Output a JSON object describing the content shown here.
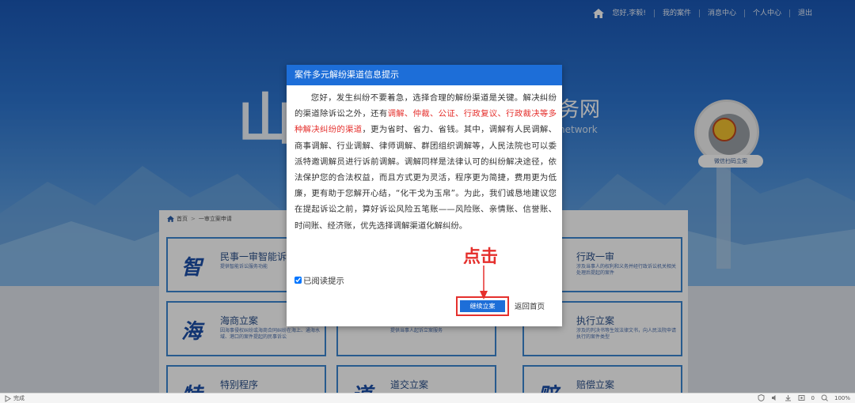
{
  "topnav": {
    "greeting": "您好,李毅!",
    "items": [
      "我的案件",
      "消息中心",
      "个人中心",
      "退出"
    ]
  },
  "hero": {
    "title_left": "山东",
    "title_right": "务网",
    "subtitle_right": "network",
    "qr_label": "微信扫码立案"
  },
  "breadcrumb": {
    "home": "首页",
    "current": "一审立案申请"
  },
  "cards": [
    {
      "glyph": "智",
      "title": "民事一审智能诉",
      "desc": "提供智能诉讼服务功能"
    },
    {
      "glyph": "",
      "title": "行政一审",
      "desc": "涉及当事人的权利和义务并经行政诉讼机关相关处理后提起的案件"
    },
    {
      "glyph": "海",
      "title": "海商立案",
      "desc": "因海事侵权纠纷或海商合同纠纷在海上、通海水域、港口的案件提起的民事诉讼"
    },
    {
      "glyph": "",
      "title": "",
      "desc": "提供当事人起诉立案服务"
    },
    {
      "glyph": "",
      "title": "执行立案",
      "desc": "涉及的判决书等生效法律文书，向人民法院申请执行的案件类型"
    },
    {
      "glyph": "特",
      "title": "特别程序",
      "desc": ""
    },
    {
      "glyph": "道",
      "title": "道交立案",
      "desc": ""
    },
    {
      "glyph": "赔",
      "title": "赔偿立案",
      "desc": ""
    }
  ],
  "modal": {
    "title": "案件多元解纷渠道信息提示",
    "body_1": "您好，发生纠纷不要着急，选择合理的解纷渠道是关键。解决纠纷的渠道除诉讼之外，还有",
    "body_red": "调解、仲裁、公证、行政复议、行政裁决等多种解决纠纷的渠道",
    "body_2": "，更为省时、省力、省钱。其中，调解有人民调解、商事调解、行业调解、律师调解、群团组织调解等，人民法院也可以委派特邀调解员进行诉前调解。调解同样是法律认可的纠纷解决途径，依法保护您的合法权益，而且方式更为灵活，程序更为简捷，费用更为低廉，更有助于您解开心结，“化干戈为玉帛”。为此，我们诚恳地建议您在提起诉讼之前，算好诉讼风险五笔账——风险账、亲情账、信誉账、时间账、经济账，优先选择调解渠道化解纠纷。",
    "ack_label": "已阅读提示",
    "ack_checked": true,
    "confirm_label": "继续立案",
    "back_label": "返回首页"
  },
  "annotation": {
    "click_hint": "点击",
    "color": "#e5302d"
  },
  "statusbar": {
    "left_text": "完成",
    "zoom": "100%",
    "count": "0"
  },
  "colors": {
    "primary_blue": "#1d6ed8",
    "card_border": "#3b86d1",
    "highlight_red": "#e5302d"
  }
}
